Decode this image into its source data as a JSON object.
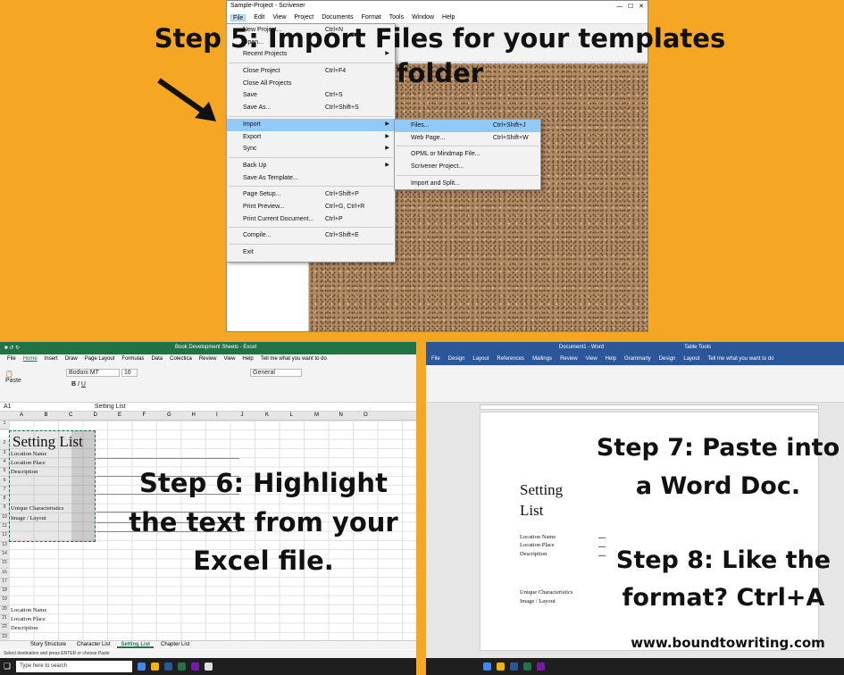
{
  "steps": {
    "step5": "Step 5: Import Files for your templates folder",
    "step6": "Step 6: Highlight the text from your Excel file.",
    "step7": "Step 7: Paste into a Word Doc.",
    "step8": "Step 8: Like the format? Ctrl+A",
    "website": "www.boundtowriting.com"
  },
  "scrivener": {
    "title": "Sample-Project - Scrivener",
    "menubar": [
      "File",
      "Edit",
      "View",
      "Project",
      "Documents",
      "Format",
      "Tools",
      "Window",
      "Help"
    ],
    "file_menu": [
      {
        "label": "New Project...",
        "shortcut": "Ctrl+N"
      },
      {
        "label": "Open...",
        "shortcut": ""
      },
      {
        "label": "Recent Projects",
        "shortcut": "",
        "arrow": true
      },
      {
        "sep": true
      },
      {
        "label": "Close Project",
        "shortcut": "Ctrl+F4"
      },
      {
        "label": "Close All Projects",
        "shortcut": ""
      },
      {
        "label": "Save",
        "shortcut": "Ctrl+S"
      },
      {
        "label": "Save As...",
        "shortcut": "Ctrl+Shift+S"
      },
      {
        "sep": true
      },
      {
        "label": "Import",
        "shortcut": "",
        "arrow": true,
        "highlight": true
      },
      {
        "label": "Export",
        "shortcut": "",
        "arrow": true
      },
      {
        "label": "Sync",
        "shortcut": "",
        "arrow": true
      },
      {
        "sep": true
      },
      {
        "label": "Back Up",
        "shortcut": "",
        "arrow": true
      },
      {
        "label": "Save As Template...",
        "shortcut": ""
      },
      {
        "sep": true
      },
      {
        "label": "Page Setup...",
        "shortcut": "Ctrl+Shift+P"
      },
      {
        "label": "Print Preview...",
        "shortcut": "Ctrl+G, Ctrl+R"
      },
      {
        "label": "Print Current Document...",
        "shortcut": "Ctrl+P"
      },
      {
        "sep": true
      },
      {
        "label": "Compile...",
        "shortcut": "Ctrl+Shift+E"
      },
      {
        "sep": true
      },
      {
        "label": "Exit",
        "shortcut": ""
      }
    ],
    "import_menu": [
      {
        "label": "Files...",
        "shortcut": "Ctrl+Shift+J",
        "highlight": true
      },
      {
        "label": "Web Page...",
        "shortcut": "Ctrl+Shift+W"
      },
      {
        "sep": true
      },
      {
        "label": "OPML or Mindmap File...",
        "shortcut": ""
      },
      {
        "label": "Scrivener Project...",
        "shortcut": ""
      },
      {
        "sep": true
      },
      {
        "label": "Import and Split...",
        "shortcut": ""
      }
    ]
  },
  "excel": {
    "title": "Book Development Sheets - Excel",
    "tabs": [
      "File",
      "Home",
      "Insert",
      "Draw",
      "Page Layout",
      "Formulas",
      "Data",
      "Colectica",
      "Review",
      "View",
      "Help",
      "Tell me what you want to do"
    ],
    "font": "Bodoni MT",
    "font_size": "16",
    "number_format": "General",
    "name_box": "A1",
    "formula": "Setting List",
    "columns": [
      "A",
      "B",
      "C",
      "D",
      "E",
      "F",
      "G",
      "H",
      "I",
      "J",
      "K",
      "L",
      "M",
      "N",
      "O"
    ],
    "heading": "Setting List",
    "rows": [
      {
        "n": "3",
        "text": "Location Name"
      },
      {
        "n": "4",
        "text": "Location Place"
      },
      {
        "n": "5",
        "text": "Description"
      },
      {
        "n": "9",
        "text": "Unique Characteristics"
      },
      {
        "n": "10",
        "text": "Image / Layout"
      },
      {
        "n": "20",
        "text": "Location Name"
      },
      {
        "n": "21",
        "text": "Location Place"
      },
      {
        "n": "22",
        "text": "Description"
      }
    ],
    "sheet_tabs": [
      "Story Structure",
      "Character List",
      "Setting List",
      "Chapter List"
    ],
    "active_sheet": "Setting List",
    "status": "Select destination and press ENTER or choose Paste",
    "search": "Type here to search"
  },
  "word": {
    "title": "Document1 - Word",
    "context": "Table Tools",
    "tabs": [
      "File",
      "Design",
      "Layout",
      "References",
      "Mailings",
      "Review",
      "View",
      "Help",
      "Grammarly",
      "Design",
      "Layout",
      "Tell me what you want to do"
    ],
    "heading_line1": "Setting",
    "heading_line2": "List",
    "items": [
      "Location Name",
      "Location Place",
      "Description",
      "Unique Characteristics",
      "Image / Layout"
    ]
  },
  "colors": {
    "bg": "#f5a623",
    "excel": "#217346",
    "word": "#2b579a",
    "menu_highlight": "#91c9f7"
  }
}
